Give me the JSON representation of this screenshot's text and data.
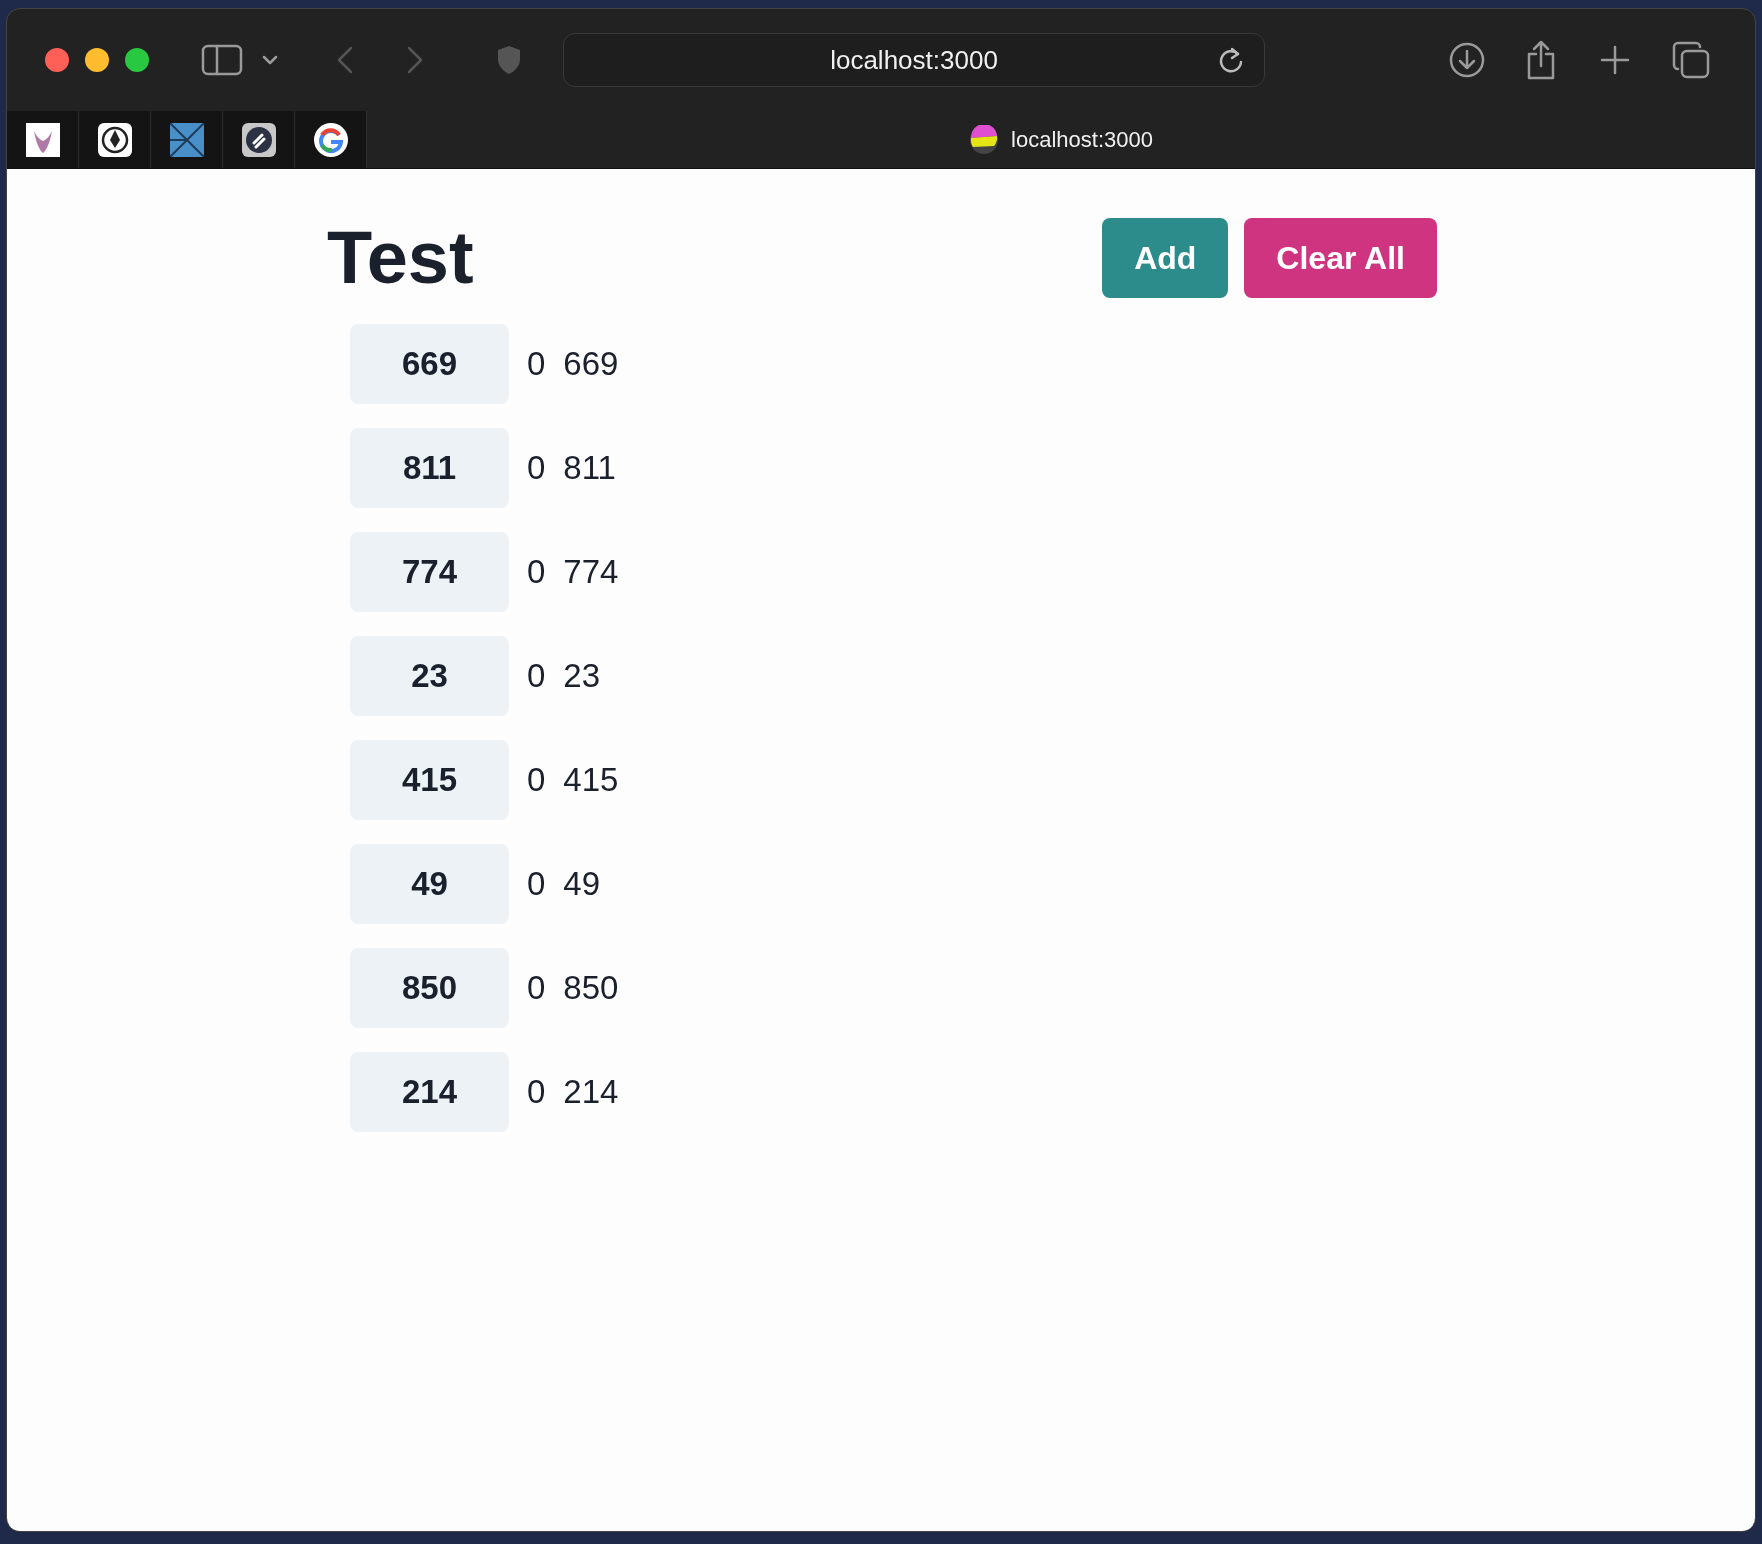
{
  "browser": {
    "address": "localhost:3000",
    "tab": {
      "title": "localhost:3000"
    }
  },
  "page": {
    "title": "Test",
    "buttons": [
      {
        "label": "Add",
        "kind": "primary"
      },
      {
        "label": "Clear All",
        "kind": "danger"
      }
    ],
    "items": [
      {
        "chip": "669",
        "index": "0",
        "value": "669"
      },
      {
        "chip": "811",
        "index": "0",
        "value": "811"
      },
      {
        "chip": "774",
        "index": "0",
        "value": "774"
      },
      {
        "chip": "23",
        "index": "0",
        "value": "23"
      },
      {
        "chip": "415",
        "index": "0",
        "value": "415"
      },
      {
        "chip": "49",
        "index": "0",
        "value": "49"
      },
      {
        "chip": "850",
        "index": "0",
        "value": "850"
      },
      {
        "chip": "214",
        "index": "0",
        "value": "214"
      }
    ]
  }
}
